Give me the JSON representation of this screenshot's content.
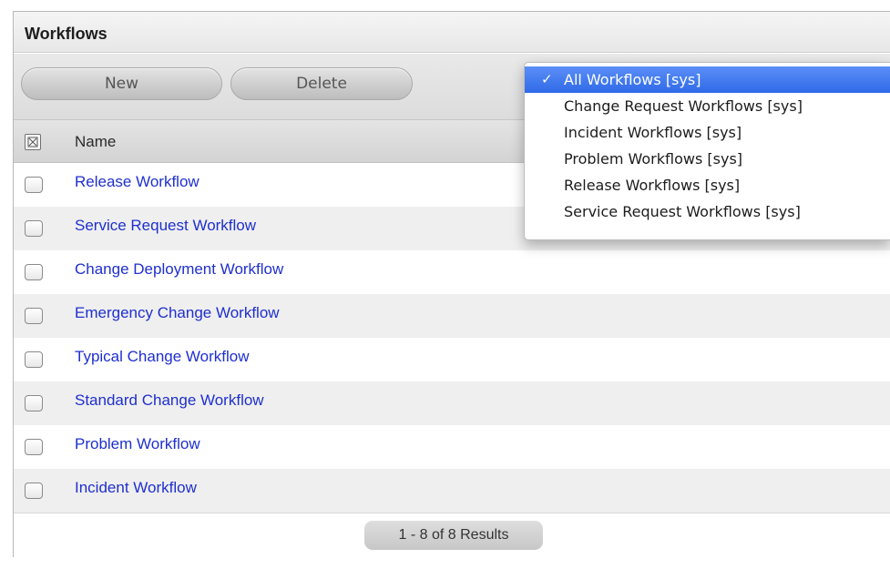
{
  "panel": {
    "title": "Workflows"
  },
  "toolbar": {
    "new_label": "New",
    "delete_label": "Delete"
  },
  "table": {
    "column_name": "Name",
    "rows": [
      "Release Workflow",
      "Service Request Workflow",
      "Change Deployment Workflow",
      "Emergency Change Workflow",
      "Typical Change Workflow",
      "Standard Change Workflow",
      "Problem Workflow",
      "Incident Workflow"
    ]
  },
  "footer": {
    "results": "1 - 8 of 8 Results"
  },
  "filter_dropdown": {
    "check_glyph": "✓",
    "selected": "All Workflows [sys]",
    "options": [
      "All Workflows [sys]",
      "Change Request Workflows [sys]",
      "Incident Workflows [sys]",
      "Problem Workflows [sys]",
      "Release Workflows [sys]",
      "Service Request Workflows [sys]"
    ]
  },
  "colors": {
    "link": "#1f2fcf",
    "selected_option": "#2f6ae8"
  }
}
